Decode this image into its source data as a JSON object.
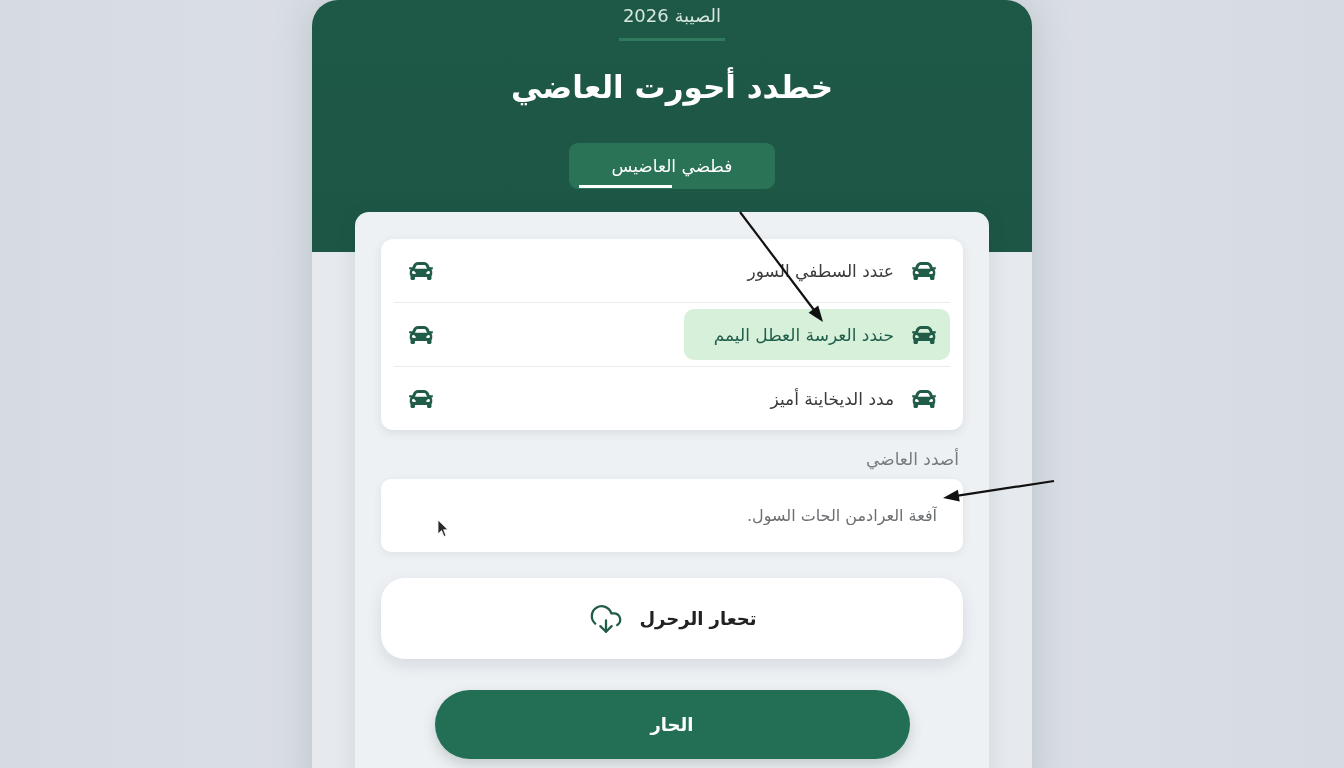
{
  "header": {
    "caption": "الصيبة 2026",
    "title": "خطدد أحورت العاضي",
    "tabs": [
      {
        "label": "فطضي العاضيس",
        "selected": true
      }
    ]
  },
  "options": [
    {
      "label": "عتدد السطفي السور",
      "selected": false
    },
    {
      "label": "حندد العرسة العطل اليمم",
      "selected": true
    },
    {
      "label": "مدد الديخاينة أميز",
      "selected": false
    }
  ],
  "field": {
    "label": "أصدد العاضي",
    "placeholder": "آفعة العرادمن الحات السول."
  },
  "download_button": {
    "label": "تحعار الرحرل"
  },
  "primary_button": {
    "label": "الحار"
  }
}
